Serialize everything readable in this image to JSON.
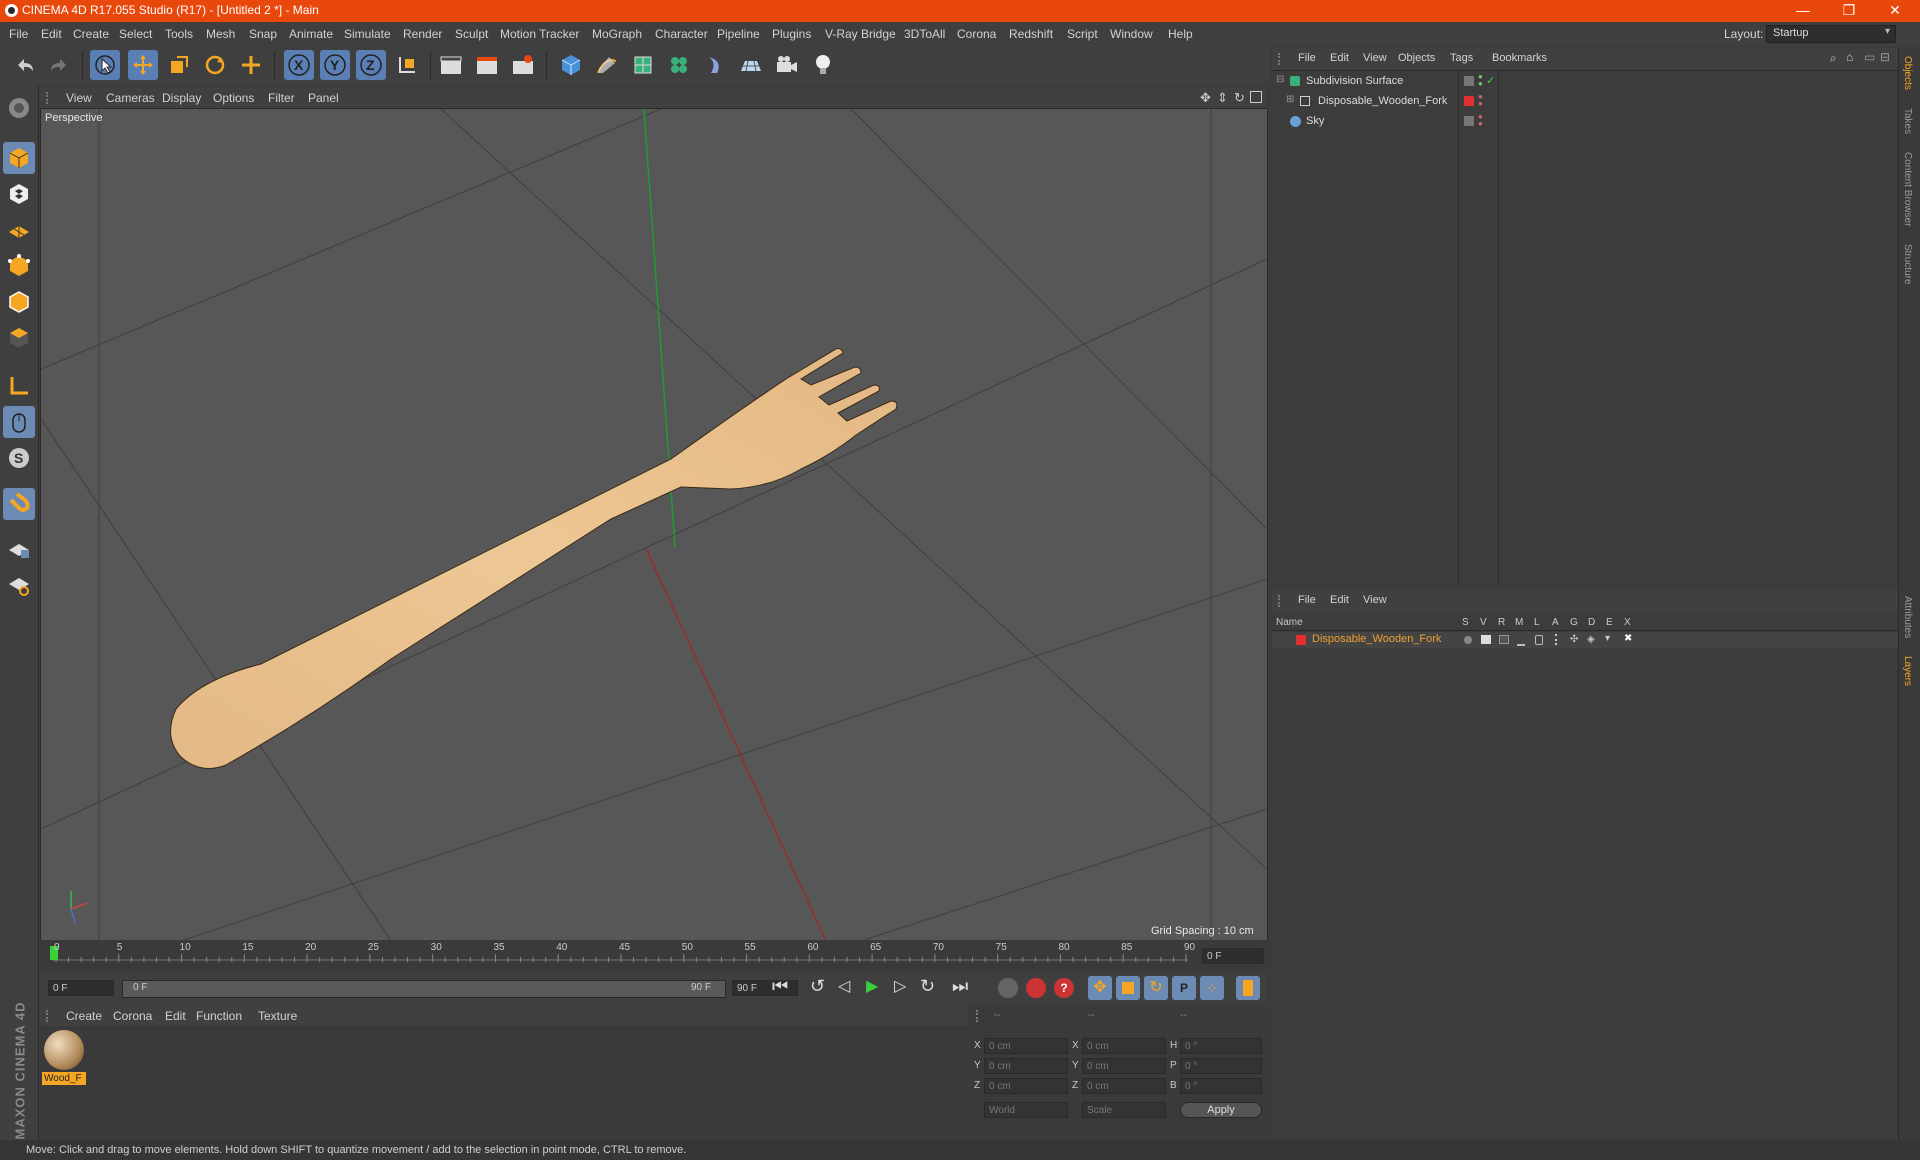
{
  "window": {
    "title": "CINEMA 4D R17.055 Studio (R17) - [Untitled 2 *] - Main",
    "minimize": "—",
    "restore": "❐",
    "close": "✕"
  },
  "menubar": {
    "items": [
      "File",
      "Edit",
      "Create",
      "Select",
      "Tools",
      "Mesh",
      "Snap",
      "Animate",
      "Simulate",
      "Render",
      "Sculpt",
      "Motion Tracker",
      "MoGraph",
      "Character",
      "Pipeline",
      "Plugins",
      "V-Ray Bridge",
      "3DToAll",
      "Corona",
      "Redshift",
      "Script",
      "Window",
      "Help"
    ],
    "layout_label": "Layout:",
    "layout_value": "Startup"
  },
  "viewport": {
    "menu": [
      "View",
      "Cameras",
      "Display",
      "Options",
      "Filter",
      "Panel"
    ],
    "camera_label": "Perspective",
    "grid_spacing": "Grid Spacing : 10 cm"
  },
  "timeline": {
    "ticks": [
      "0",
      "5",
      "10",
      "15",
      "20",
      "25",
      "30",
      "35",
      "40",
      "45",
      "50",
      "55",
      "60",
      "65",
      "70",
      "75",
      "80",
      "85",
      "90"
    ],
    "current_frame": "0 F",
    "start_field": "0 F",
    "range_start": "0 F",
    "range_end": "90 F",
    "end_field": "90 F"
  },
  "material_manager": {
    "menu": [
      "Create",
      "Corona",
      "Edit",
      "Function",
      "Texture"
    ],
    "material_name": "Wood_F"
  },
  "coordinates": {
    "headers": [
      "--",
      "--",
      "--"
    ],
    "rows": [
      {
        "a": "X",
        "av": "0 cm",
        "b": "X",
        "bv": "0 cm",
        "c": "H",
        "cv": "0 °"
      },
      {
        "a": "Y",
        "av": "0 cm",
        "b": "Y",
        "bv": "0 cm",
        "c": "P",
        "cv": "0 °"
      },
      {
        "a": "Z",
        "av": "0 cm",
        "b": "Z",
        "bv": "0 cm",
        "c": "B",
        "cv": "0 °"
      }
    ],
    "mode": "World",
    "scale": "Scale",
    "apply": "Apply"
  },
  "object_manager": {
    "menu": [
      "File",
      "Edit",
      "View",
      "Objects",
      "Tags",
      "Bookmarks"
    ],
    "objects": [
      {
        "name": "Subdivision Surface"
      },
      {
        "name": "Disposable_Wooden_Fork"
      },
      {
        "name": "Sky"
      }
    ]
  },
  "layer_manager": {
    "menu": [
      "File",
      "Edit",
      "View"
    ],
    "header_name": "Name",
    "columns": [
      "S",
      "V",
      "R",
      "M",
      "L",
      "A",
      "G",
      "D",
      "E",
      "X"
    ],
    "layers": [
      {
        "name": "Disposable_Wooden_Fork",
        "color": "#e03030"
      }
    ]
  },
  "side_tabs": [
    "Objects",
    "Takes",
    "Content Browser",
    "Structure",
    "Attributes",
    "Layers"
  ],
  "branding": "MAXON CINEMA 4D",
  "statusbar": {
    "text": "Move: Click and drag to move elements. Hold down SHIFT to quantize movement / add to the selection in point mode, CTRL to remove."
  },
  "colors": {
    "accent": "#e8480c",
    "active_tool": "#5a7fb5",
    "layer_text": "#f0a030"
  }
}
